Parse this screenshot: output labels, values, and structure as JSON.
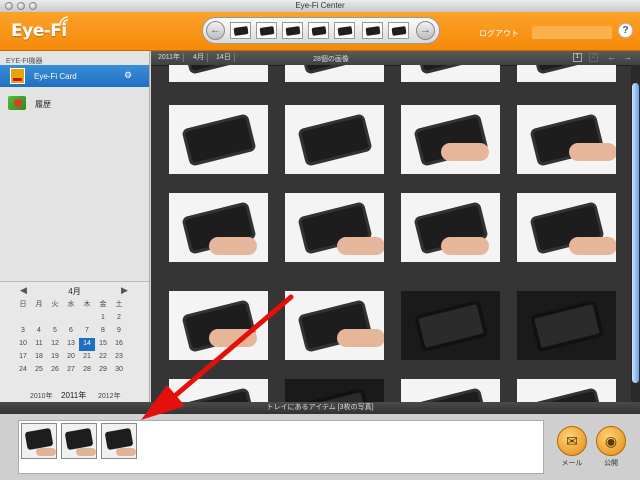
{
  "window": {
    "title": "Eye-Fi Center"
  },
  "header": {
    "logo": "Eye-Fi",
    "logout": "ログアウト",
    "help": "?",
    "nav_prev": "←",
    "nav_next": "→"
  },
  "sidebar": {
    "section_title": "EYE-FI機器",
    "card_label": "Eye-Fi Card",
    "history_label": "履歴"
  },
  "calendar": {
    "prev": "◀",
    "next": "▶",
    "month": "4月",
    "weekdays": [
      "日",
      "月",
      "火",
      "水",
      "木",
      "金",
      "土"
    ],
    "weeks": [
      [
        "",
        "",
        "",
        "1",
        "2",
        "3",
        " "
      ],
      [
        "",
        "",
        "",
        "",
        "",
        "",
        "9"
      ],
      [
        "",
        "",
        "",
        "",
        "",
        "",
        ""
      ],
      [
        "",
        "",
        "",
        "",
        "",
        "",
        ""
      ],
      [
        "",
        "",
        "",
        "",
        "",
        "",
        ""
      ]
    ],
    "days": [
      [
        "",
        "",
        "",
        "",
        "",
        "1",
        "2"
      ],
      [
        "3",
        "4",
        "5",
        "6",
        "7",
        "8",
        "9"
      ],
      [
        "10",
        "11",
        "12",
        "13",
        "14",
        "15",
        "16"
      ],
      [
        "17",
        "18",
        "19",
        "20",
        "21",
        "22",
        "23"
      ],
      [
        "24",
        "25",
        "26",
        "27",
        "28",
        "29",
        "30"
      ]
    ],
    "selected_day": "14",
    "year_prev": "2010年",
    "year_current": "2011年",
    "year_next": "2012年"
  },
  "main": {
    "crumb_year": "2011年",
    "crumb_month": "4月",
    "crumb_day": "14日",
    "photo_count": "28個の画像",
    "view_single": "1",
    "view_multi": "2",
    "arrow_left": "←",
    "arrow_right": "→"
  },
  "tray": {
    "title": "トレイにあるアイテム [3枚の写真]",
    "mail_label": "メール",
    "publish_label": "公開"
  },
  "colors": {
    "header_orange": "#f7920f",
    "selection_blue": "#1f6fc0",
    "annotation_red": "#e5100c"
  }
}
